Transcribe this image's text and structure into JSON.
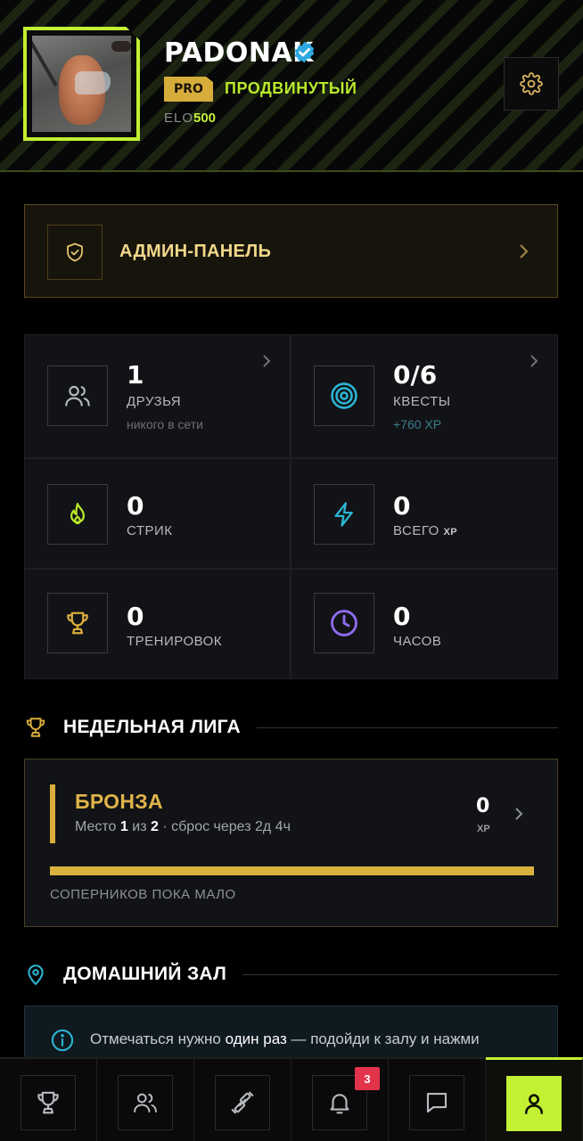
{
  "profile": {
    "username": "PADONAK",
    "badge": "PRO",
    "level": "ПРОДВИНУТЫЙ",
    "elo_label": "ELO",
    "elo_value": "500"
  },
  "admin": {
    "label": "АДМИН-ПАНЕЛЬ"
  },
  "stats": {
    "friends": {
      "value": "1",
      "label": "ДРУЗЬЯ",
      "sub": "никого в сети"
    },
    "quests": {
      "value": "0/6",
      "label": "КВЕСТЫ",
      "sub": "+760 XP"
    },
    "streak": {
      "value": "0",
      "label": "СТРИК"
    },
    "total_xp": {
      "value": "0",
      "label": "ВСЕГО",
      "label_suffix": "XP"
    },
    "workouts": {
      "value": "0",
      "label": "ТРЕНИРОВОК"
    },
    "hours": {
      "value": "0",
      "label": "ЧАСОВ"
    }
  },
  "league": {
    "title": "НЕДЕЛЬНАЯ ЛИГА",
    "tier": "БРОНЗА",
    "place_prefix": "Место",
    "place": "1",
    "of_word": "из",
    "total": "2",
    "reset_text": "· сброс через 2д 4ч",
    "xp_value": "0",
    "xp_label": "XP",
    "progress": 1.0,
    "note": "СОПЕРНИКОВ ПОКА МАЛО"
  },
  "home_gym": {
    "title": "ДОМАШНИЙ ЗАЛ",
    "info_prefix": "Отмечаться нужно",
    "info_bold": "один раз",
    "info_suffix": "— подойди к залу и нажми"
  },
  "nav": {
    "notifications_count": "3",
    "tabs": [
      "trophy-icon",
      "friends-icon",
      "dumbbell-icon",
      "bell-icon",
      "chat-icon",
      "profile-icon"
    ]
  },
  "colors": {
    "accent": "#c2f032",
    "gold": "#d8ad3c",
    "cyan": "#2bb6d4",
    "purple": "#8f6cf0",
    "badge_red": "#e2334b"
  }
}
